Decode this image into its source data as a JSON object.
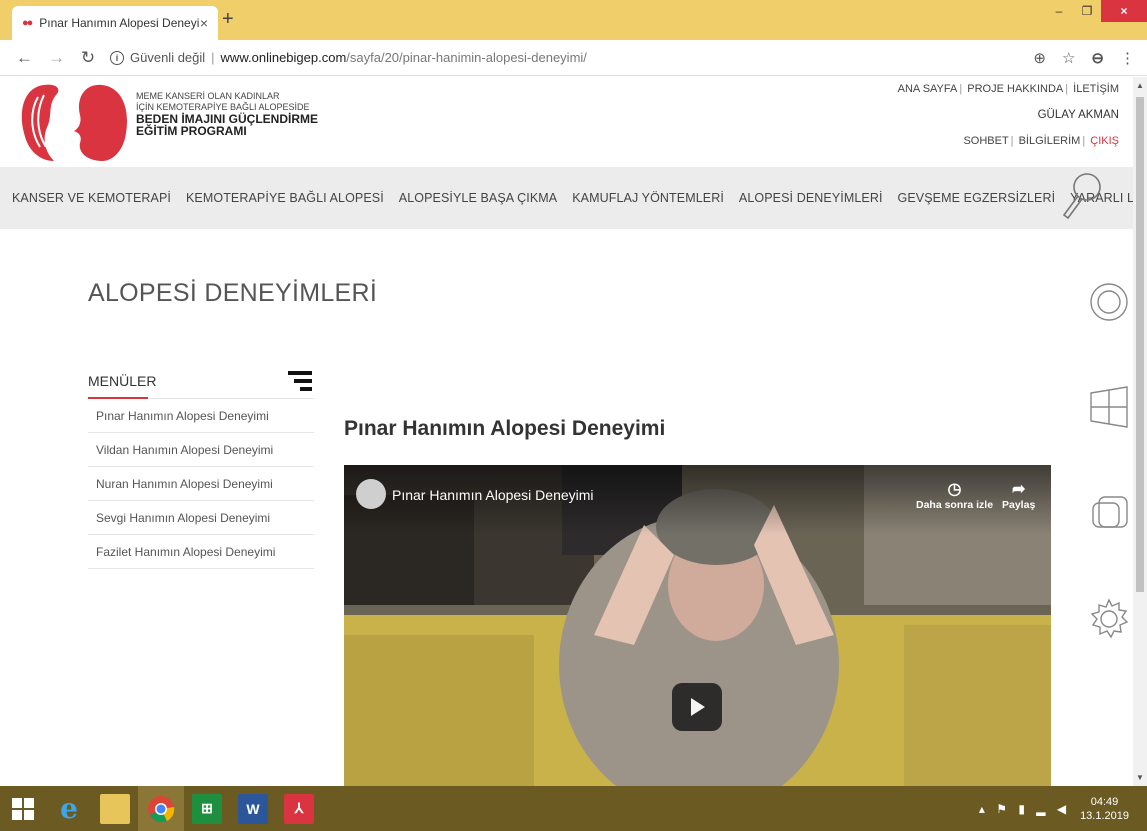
{
  "browser": {
    "tab_title": "Pınar Hanımın Alopesi Deneyimi",
    "tab_close": "×",
    "new_tab": "+",
    "url_security": "Güvenli değil",
    "url_host": "www.onlinebigep.com",
    "url_path": "/sayfa/20/pinar-hanimin-alopesi-deneyimi/",
    "window_minimize": "–",
    "window_restore": "❐",
    "window_close": "×"
  },
  "site": {
    "logo_line1": "MEME KANSERİ OLAN KADINLAR",
    "logo_line2": "İÇİN KEMOTERAPİYE BAĞLI ALOPESİDE",
    "logo_line3": "BEDEN İMAJINI GÜÇLENDİRME",
    "logo_line4": "EĞİTİM PROGRAMI",
    "top_links": [
      "ANA SAYFA",
      "PROJE HAKKINDA",
      "İLETİŞİM"
    ],
    "user_name": "GÜLAY AKMAN",
    "user_links": [
      "SOHBET",
      "BİLGİLERİM",
      "ÇIKIŞ"
    ],
    "menu": [
      "KANSER VE KEMOTERAPİ",
      "KEMOTERAPİYE BAĞLI ALOPESİ",
      "ALOPESİYLE BAŞA ÇIKMA",
      "KAMUFLAJ YÖNTEMLERİ",
      "ALOPESİ DENEYİMLERİ",
      "GEVŞEME EGZERSİZLERİ",
      "YARARLI LİNKLER"
    ]
  },
  "page": {
    "title": "ALOPESİ DENEYİMLERİ",
    "sidebar_heading": "MENÜLER",
    "sidebar_items": [
      "Pınar Hanımın Alopesi Deneyimi",
      "Vildan Hanımın Alopesi Deneyimi",
      "Nuran Hanımın Alopesi Deneyimi",
      "Sevgi Hanımın Alopesi Deneyimi",
      "Fazilet Hanımın Alopesi Deneyimi"
    ],
    "content_title": "Pınar Hanımın Alopesi Deneyimi"
  },
  "video": {
    "title": "Pınar Hanımın Alopesi Deneyimi",
    "watch_later": "Daha sonra izle",
    "share": "Paylaş"
  },
  "taskbar": {
    "time": "04:49",
    "date": "13.1.2019"
  },
  "colors": {
    "accent": "#d9343f",
    "title_bar": "#f0cf6b",
    "taskbar": "#6b5a22"
  }
}
